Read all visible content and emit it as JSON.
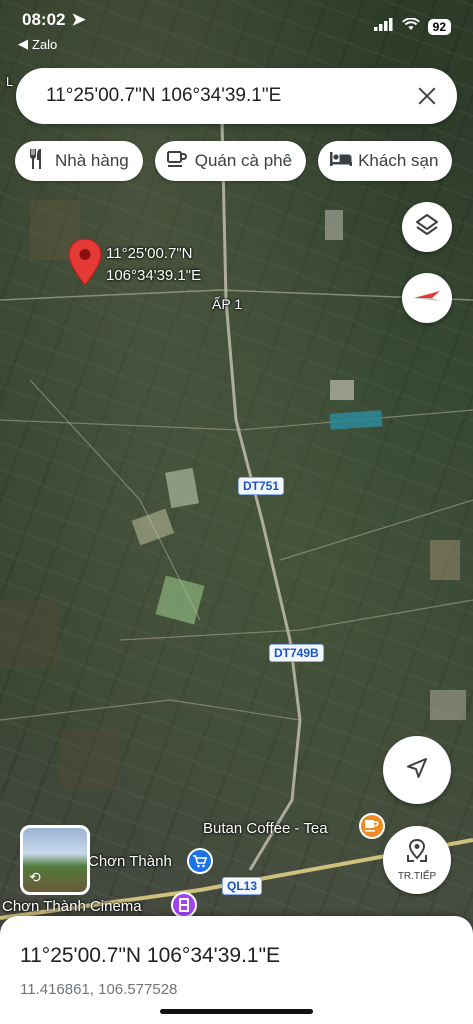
{
  "status_bar": {
    "time": "08:02",
    "back_app": "Zalo",
    "battery": "92"
  },
  "search": {
    "value": "11°25'00.7\"N 106°34'39.1\"E"
  },
  "chips": [
    {
      "label": "Nhà hàng",
      "icon": "restaurant-icon"
    },
    {
      "label": "Quán cà phê",
      "icon": "coffee-icon"
    },
    {
      "label": "Khách sạn",
      "icon": "hotel-icon"
    }
  ],
  "map": {
    "pin_label_line1": "11°25'00.7\"N",
    "pin_label_line2": "106°34'39.1\"E",
    "area_label": "ẤP 1",
    "roads": [
      "DT751",
      "DT749B",
      "QL13"
    ],
    "poi_coffee": "Butan Coffee - Tea",
    "poi_chon_thanh": "Chơn Thành",
    "poi_cinema": "Chơn Thành Cinema",
    "edge_label": "L",
    "colors": {
      "pin_red": "#e53935",
      "road_badge_text": "#1a56c9",
      "coffee_orange": "#f08a24",
      "shopping_blue": "#1a73e8",
      "cinema_purple": "#a142f4",
      "water_teal": "#2b8a9a"
    }
  },
  "street_view_fab": {
    "label": "TR.TIẾP"
  },
  "bottom_sheet": {
    "title": "11°25'00.7\"N 106°34'39.1\"E",
    "subtitle": "11.416861, 106.577528"
  }
}
